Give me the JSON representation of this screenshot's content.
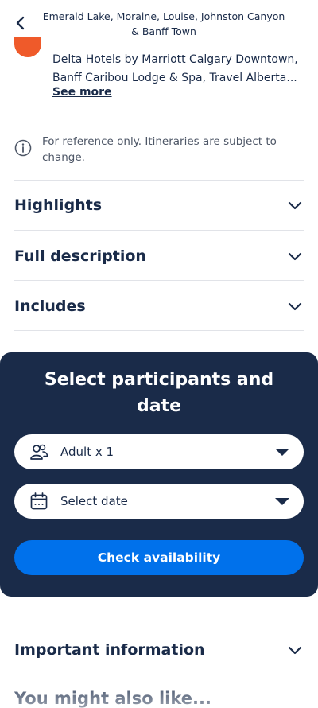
{
  "header": {
    "back_icon": "chevron-left-icon",
    "title": "Emerald Lake, Moraine, Louise, Johnston Canyon & Banff Town"
  },
  "pickup": {
    "hotels_text": "Delta Hotels by Marriott Calgary Downtown, Banff Caribou Lodge & Spa, Travel Alberta...",
    "see_more_label": "See more",
    "dot_color": "#ef5a2a"
  },
  "note": {
    "icon": "info-icon",
    "text": "For reference only. Itineraries are subject to change."
  },
  "accordions": [
    {
      "title": "Highlights"
    },
    {
      "title": "Full description"
    },
    {
      "title": "Includes"
    }
  ],
  "booking": {
    "title": "Select participants and date",
    "participants": {
      "icon": "participants-icon",
      "value": "Adult x 1"
    },
    "date": {
      "icon": "calendar-icon",
      "value": "Select date"
    },
    "check_label": "Check availability",
    "panel_color": "#1a2b49",
    "button_color": "#0071eb"
  },
  "important": {
    "title": "Important information"
  },
  "recommend": {
    "title": "You might also like..."
  }
}
